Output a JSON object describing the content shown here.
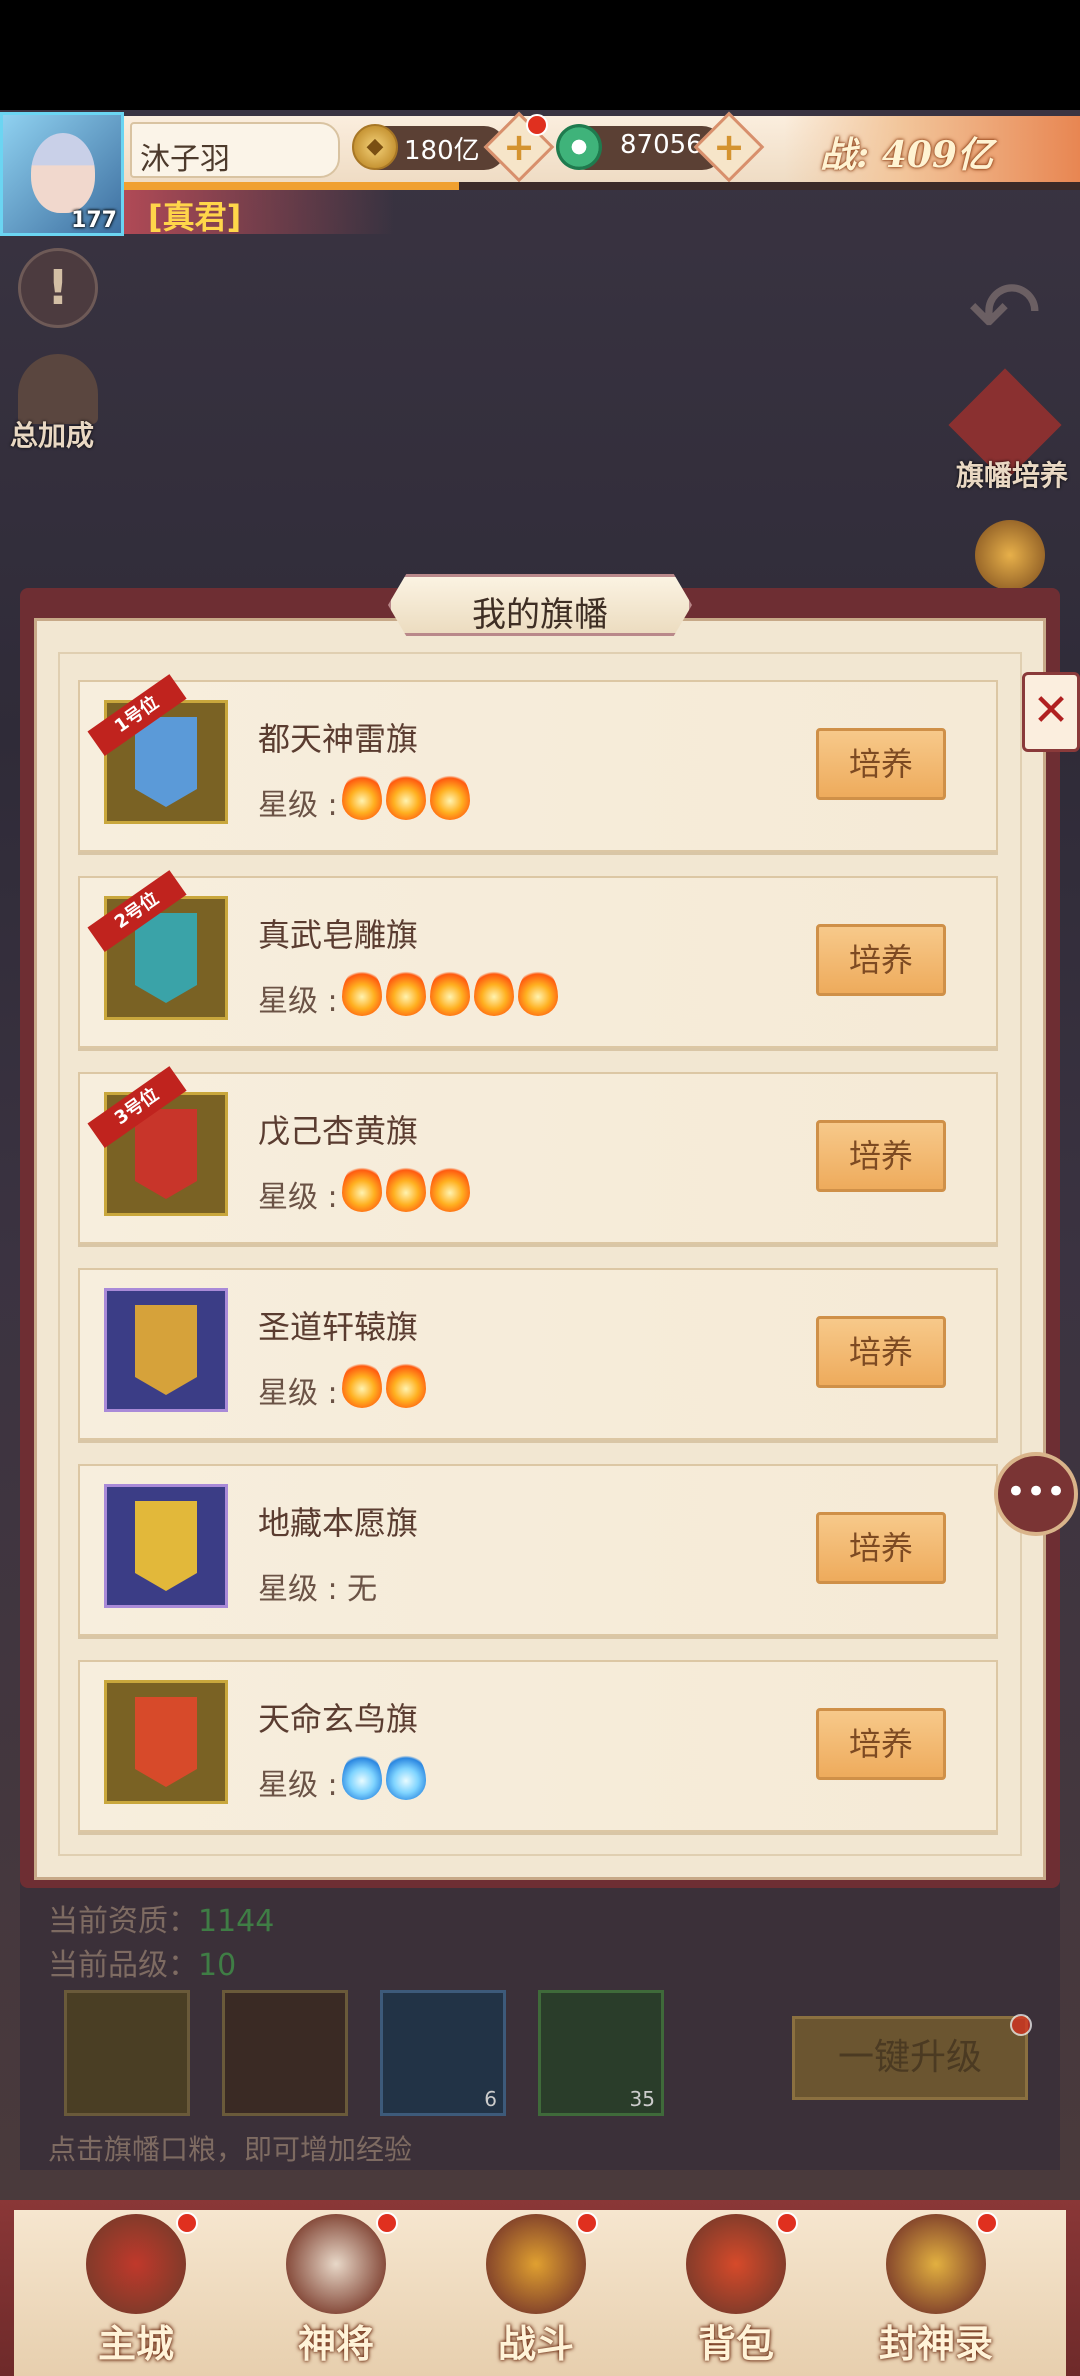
{
  "player": {
    "name": "沐子羽",
    "level": "177",
    "title": "[真君]",
    "coins": "180亿",
    "jade": "87056",
    "power": "战: 409亿",
    "plus": "+"
  },
  "side": {
    "info_icon": "!",
    "total_bonus": "总加成",
    "banner_train": "旗幡培养",
    "back_icon": "↶"
  },
  "panel": {
    "title": "我的旗幡",
    "close": "✕",
    "chat": "•••"
  },
  "flags": [
    {
      "name": "都天神雷旗",
      "star_label": "星级 :",
      "rank": "1号位",
      "stars": 3,
      "star_type": "fire",
      "button": "培养",
      "color": "#5b9ad8"
    },
    {
      "name": "真武皂雕旗",
      "star_label": "星级 :",
      "rank": "2号位",
      "stars": 5,
      "star_type": "fire",
      "button": "培养",
      "color": "#3aa3a8"
    },
    {
      "name": "戊己杏黄旗",
      "star_label": "星级 :",
      "rank": "3号位",
      "stars": 3,
      "star_type": "fire",
      "button": "培养",
      "color": "#c8352a"
    },
    {
      "name": "圣道轩辕旗",
      "star_label": "星级 :",
      "rank": "",
      "stars": 2,
      "star_type": "fire",
      "button": "培养",
      "color": "#d6a23a"
    },
    {
      "name": "地藏本愿旗",
      "star_label": "星级 : 无",
      "rank": "",
      "stars": 0,
      "star_type": "none",
      "button": "培养",
      "color": "#e2b83a"
    },
    {
      "name": "天命玄鸟旗",
      "star_label": "星级 :",
      "rank": "",
      "stars": 2,
      "star_type": "blue",
      "button": "培养",
      "color": "#d74a2a"
    }
  ],
  "under": {
    "aptitude_label": "当前资质：",
    "aptitude_value": "1144",
    "grade_label": "当前品级：",
    "grade_value": "10",
    "slot_count_1": "6",
    "slot_count_2": "35",
    "upgrade": "一键升级",
    "hint": "点击旗幡口粮，即可增加经验"
  },
  "nav": [
    {
      "label": "主城"
    },
    {
      "label": "神将"
    },
    {
      "label": "战斗"
    },
    {
      "label": "背包"
    },
    {
      "label": "封神录"
    }
  ]
}
